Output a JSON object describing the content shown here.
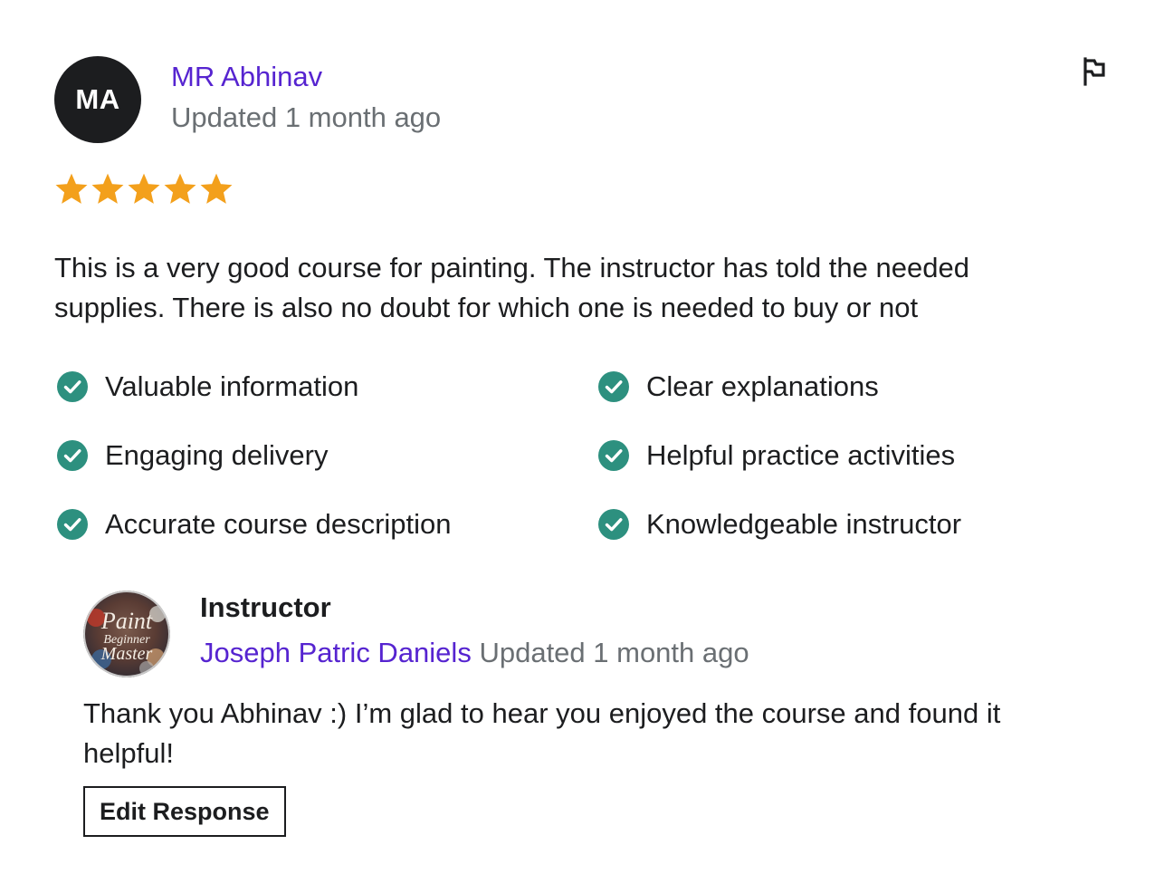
{
  "review": {
    "avatar_initials": "MA",
    "reviewer_name": "MR Abhinav",
    "updated": "Updated 1 month ago",
    "rating": 5,
    "rating_max": 5,
    "text": "This is a very good course for painting. The instructor has told the needed supplies. There is also no doubt for which one is needed to buy or not",
    "flag_icon": "flag-icon",
    "star_color": "#f3a01c",
    "tags": [
      "Valuable information",
      "Clear explanations",
      "Engaging delivery",
      "Helpful practice activities",
      "Accurate course description",
      "Knowledgeable instructor"
    ],
    "tag_icon": "check-circle-icon",
    "tag_icon_color": "#2d907f"
  },
  "response": {
    "role": "Instructor",
    "avatar_logo": {
      "line1": "Paint",
      "line2": "Beginner",
      "line3": "Master"
    },
    "instructor_name": "Joseph Patric Daniels",
    "updated": "Updated 1 month ago",
    "text": "Thank you Abhinav :) I’m glad to hear you enjoyed the course and found it helpful!",
    "edit_button_label": "Edit Response"
  },
  "colors": {
    "link": "#5624d0",
    "muted": "#6a6f73",
    "text": "#1c1d1f"
  }
}
